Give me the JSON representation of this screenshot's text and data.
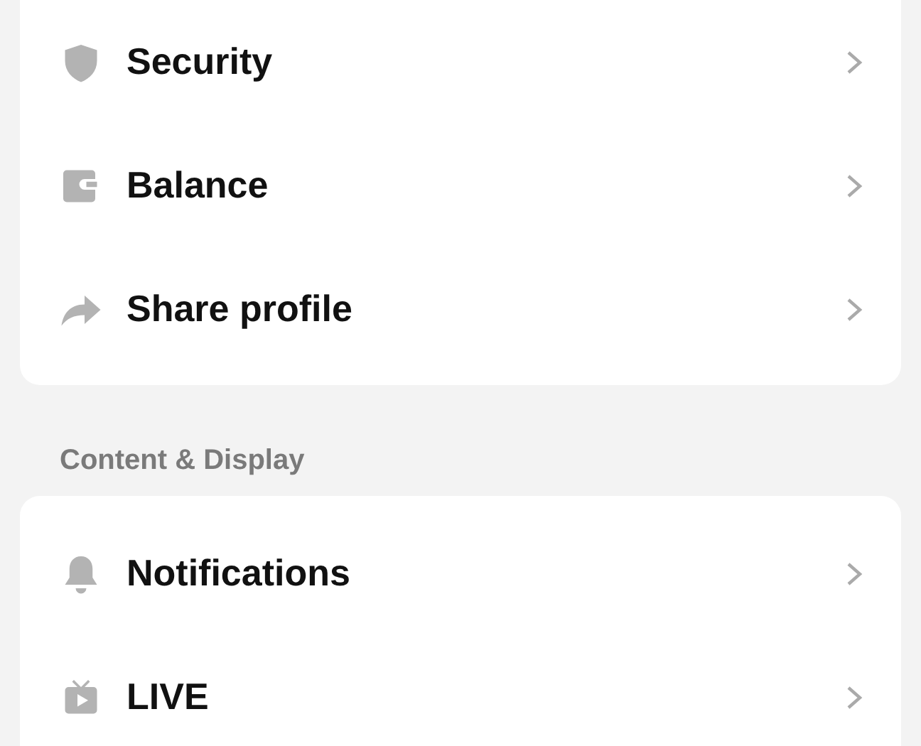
{
  "sections": [
    {
      "items": [
        {
          "kind": "shield",
          "label": "Security"
        },
        {
          "kind": "wallet",
          "label": "Balance"
        },
        {
          "kind": "share",
          "label": "Share profile"
        }
      ]
    },
    {
      "title": "Content & Display",
      "items": [
        {
          "kind": "bell",
          "label": "Notifications"
        },
        {
          "kind": "tv",
          "label": "LIVE"
        }
      ]
    }
  ]
}
